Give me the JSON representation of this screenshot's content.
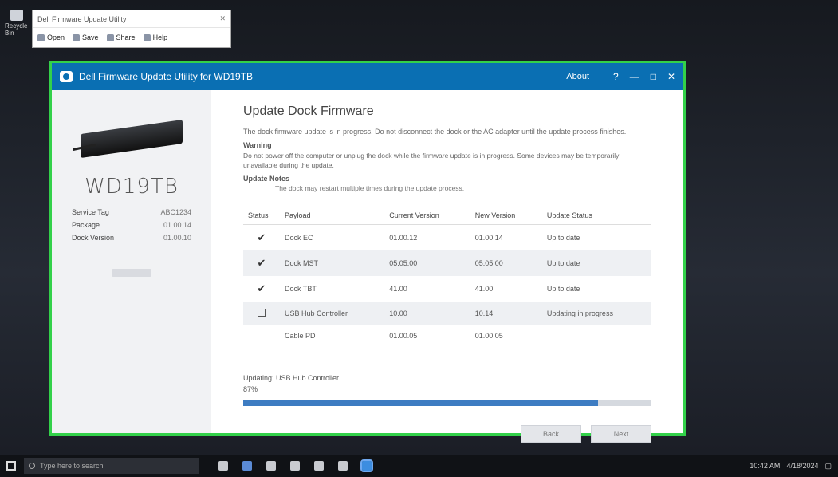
{
  "desktop": {
    "icon_label": "Recycle Bin"
  },
  "mini_window": {
    "title": "Dell Firmware Update Utility",
    "toolbar": [
      "Open",
      "Save",
      "Share",
      "Help"
    ]
  },
  "app": {
    "title": "Dell Firmware Update Utility for WD19TB",
    "header_link": "About",
    "window_buttons": [
      "?",
      "—",
      "□",
      "✕"
    ]
  },
  "sidebar": {
    "model": "WD19TB",
    "info": [
      {
        "label": "Service Tag",
        "value": "ABC1234"
      },
      {
        "label": "Package",
        "value": "01.00.14"
      },
      {
        "label": "Dock Version",
        "value": "01.00.10"
      }
    ]
  },
  "main": {
    "heading": "Update Dock Firmware",
    "intro": "The dock firmware update is in progress. Do not disconnect the dock or the AC adapter until the update process finishes.",
    "note_title": "Warning",
    "warning": "Do not power off the computer or unplug the dock while the firmware update is in progress. Some devices may be temporarily unavailable during the update.",
    "note_title_2": "Update Notes",
    "indent_note": "The dock may restart multiple times during the update process.",
    "columns": [
      "Status",
      "Payload",
      "Current Version",
      "New Version",
      "Update Status"
    ],
    "rows": [
      {
        "status": "✔",
        "payload": "Dock EC",
        "current": "01.00.12",
        "new": "01.00.14",
        "update": "Up to date",
        "shade": false
      },
      {
        "status": "✔",
        "payload": "Dock MST",
        "current": "05.05.00",
        "new": "05.05.00",
        "update": "Up to date",
        "shade": true
      },
      {
        "status": "✔",
        "payload": "Dock TBT",
        "current": "41.00",
        "new": "41.00",
        "update": "Up to date",
        "shade": false
      },
      {
        "status": "box",
        "payload": "USB Hub Controller",
        "current": "10.00",
        "new": "10.14",
        "update": "Updating in progress",
        "shade": true
      },
      {
        "status": "",
        "payload": "Cable PD",
        "current": "01.00.05",
        "new": "01.00.05",
        "update": "",
        "shade": false
      }
    ],
    "progress_label": "Updating: USB Hub Controller",
    "progress_percent": "87%",
    "progress_fraction": 0.87,
    "buttons": {
      "back": "Back",
      "next": "Next"
    }
  },
  "taskbar": {
    "search_placeholder": "Type here to search",
    "time": "10:42 AM",
    "date": "4/18/2024"
  }
}
